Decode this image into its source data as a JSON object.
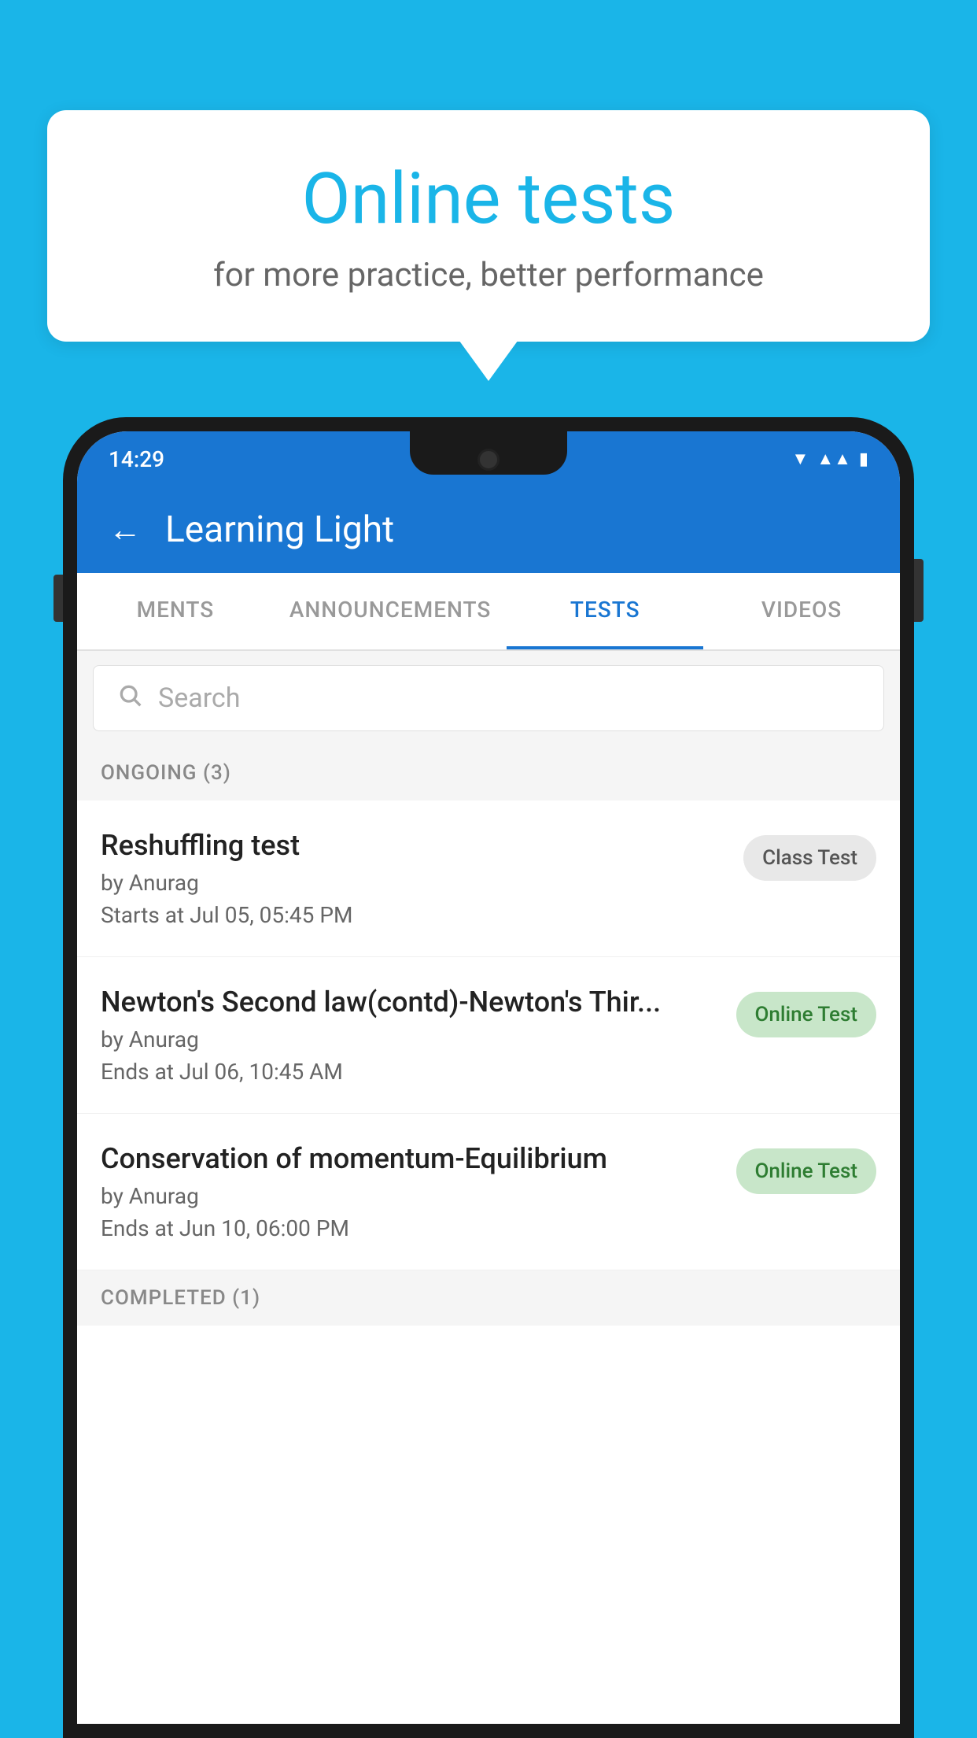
{
  "background": {
    "color": "#1ab5e8"
  },
  "speech_bubble": {
    "title": "Online tests",
    "subtitle": "for more practice, better performance"
  },
  "phone": {
    "status_bar": {
      "time": "14:29"
    },
    "app_bar": {
      "title": "Learning Light"
    },
    "tabs": [
      {
        "label": "MENTS",
        "active": false
      },
      {
        "label": "ANNOUNCEMENTS",
        "active": false
      },
      {
        "label": "TESTS",
        "active": true
      },
      {
        "label": "VIDEOS",
        "active": false
      }
    ],
    "search": {
      "placeholder": "Search"
    },
    "ongoing_section": {
      "title": "ONGOING (3)"
    },
    "tests": [
      {
        "name": "Reshuffling test",
        "author": "by Anurag",
        "time_label": "Starts at",
        "time": "Jul 05, 05:45 PM",
        "badge": "Class Test",
        "badge_type": "class"
      },
      {
        "name": "Newton's Second law(contd)-Newton's Thir...",
        "author": "by Anurag",
        "time_label": "Ends at",
        "time": "Jul 06, 10:45 AM",
        "badge": "Online Test",
        "badge_type": "online"
      },
      {
        "name": "Conservation of momentum-Equilibrium",
        "author": "by Anurag",
        "time_label": "Ends at",
        "time": "Jun 10, 06:00 PM",
        "badge": "Online Test",
        "badge_type": "online"
      }
    ],
    "completed_section": {
      "title": "COMPLETED (1)"
    }
  }
}
